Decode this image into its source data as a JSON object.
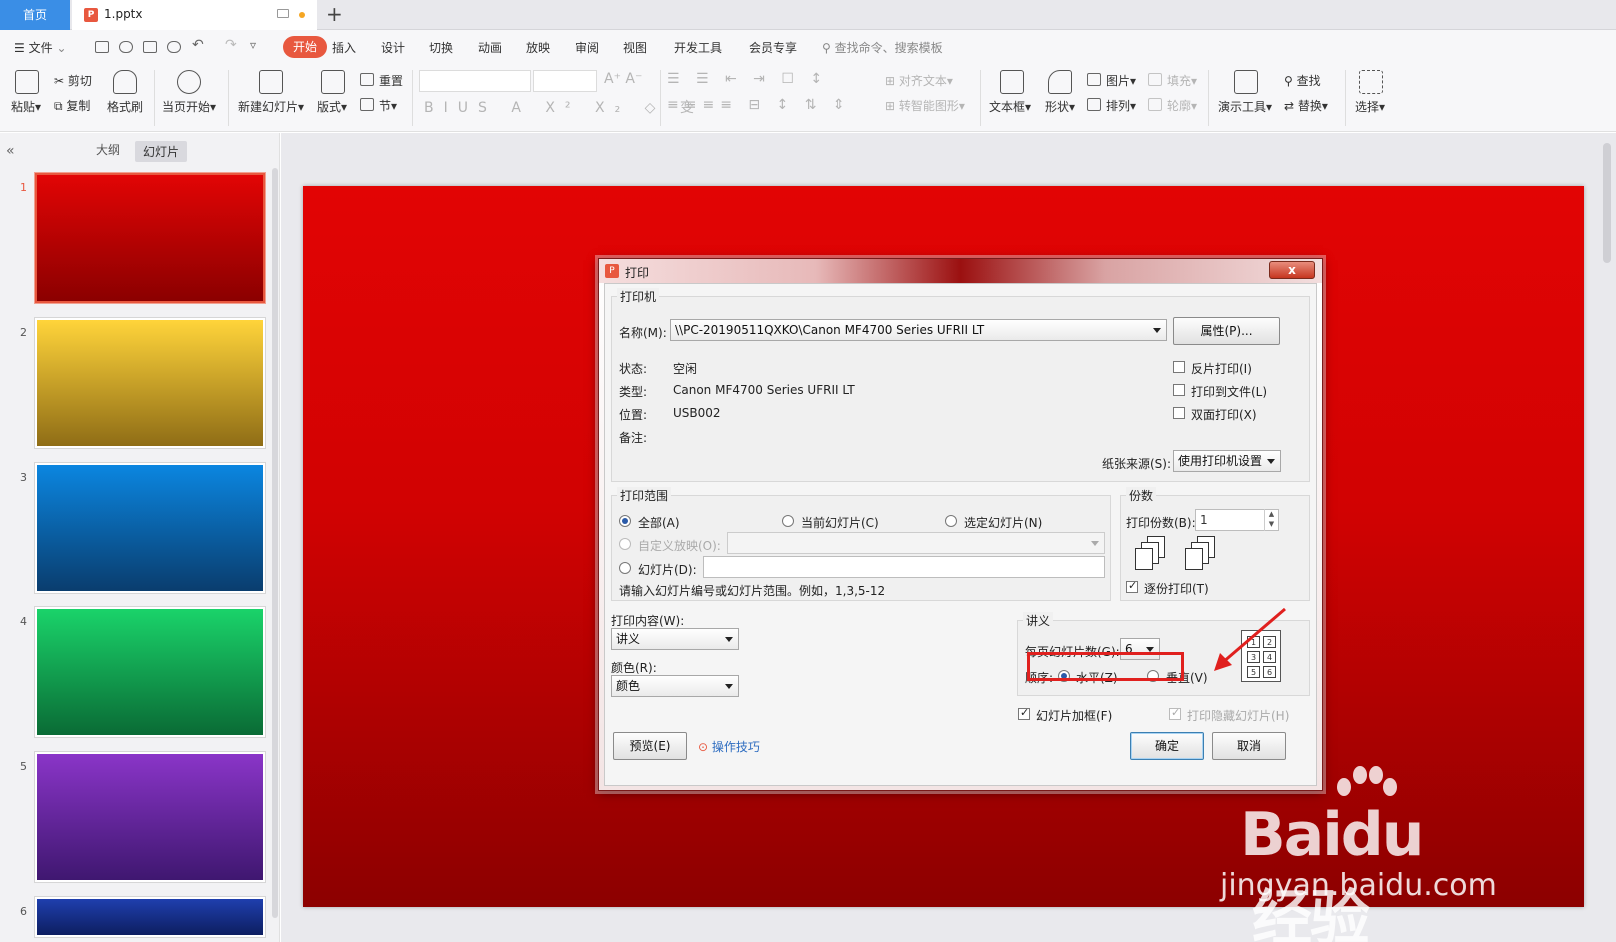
{
  "tabbar": {
    "home": "首页",
    "doc": "1.pptx",
    "logo": "P"
  },
  "menu": {
    "file": "文件",
    "tabs": [
      "开始",
      "插入",
      "设计",
      "切换",
      "动画",
      "放映",
      "审阅",
      "视图",
      "开发工具",
      "会员专享"
    ],
    "search": "查找命令、搜索模板"
  },
  "ribbon": {
    "paste": "粘贴",
    "cut": "剪切",
    "copy": "复制",
    "format_painter": "格式刷",
    "play_from_current": "当页开始",
    "new_slide": "新建幻灯片",
    "layout": "版式",
    "reset": "重置",
    "section": "节",
    "align_text": "对齐文本",
    "smart_art": "转智能图形",
    "textbox": "文本框",
    "shape": "形状",
    "arrange": "排列",
    "picture": "图片",
    "fill": "填充",
    "outline": "轮廓",
    "presentation_tools": "演示工具",
    "find": "查找",
    "replace": "替换",
    "select": "选择"
  },
  "leftpanel": {
    "tab_outline": "大纲",
    "tab_slides": "幻灯片",
    "slides": [
      {
        "num": "1",
        "top": "#e20505",
        "bottom": "#8b0000"
      },
      {
        "num": "2",
        "top": "#ffd43a",
        "bottom": "#8f6d16"
      },
      {
        "num": "3",
        "top": "#0b86e0",
        "bottom": "#0a3d6e"
      },
      {
        "num": "4",
        "top": "#1ad36a",
        "bottom": "#0a6b35"
      },
      {
        "num": "5",
        "top": "#8a35c8",
        "bottom": "#3f1770"
      },
      {
        "num": "6",
        "top": "#1f3fae",
        "bottom": "#0d1e60"
      }
    ]
  },
  "dialog": {
    "title": "打印",
    "close": "x",
    "printer_group": "打印机",
    "name_label": "名称(M):",
    "printer_name": "\\\\PC-20190511QXKO\\Canon MF4700 Series UFRII LT",
    "properties": "属性(P)...",
    "status_label": "状态:",
    "status_value": "空闲",
    "type_label": "类型:",
    "type_value": "Canon MF4700 Series UFRII LT",
    "location_label": "位置:",
    "location_value": "USB002",
    "comment_label": "备注:",
    "reverse_print": "反片打印(I)",
    "print_to_file": "打印到文件(L)",
    "duplex": "双面打印(X)",
    "paper_source_label": "纸张来源(S):",
    "paper_source": "使用打印机设置",
    "range_group": "打印范围",
    "range_all": "全部(A)",
    "range_current": "当前幻灯片(C)",
    "range_selected": "选定幻灯片(N)",
    "range_custom": "自定义放映(O):",
    "range_slides": "幻灯片(D):",
    "range_hint": "请输入幻灯片编号或幻灯片范围。例如，1,3,5-12",
    "copies_group": "份数",
    "copies_label": "打印份数(B):",
    "copies_value": "1",
    "collate": "逐份打印(T)",
    "content_label": "打印内容(W):",
    "content_value": "讲义",
    "color_label": "颜色(R):",
    "color_value": "颜色",
    "handout_group": "讲义",
    "per_page_label": "每页幻灯片数(G):",
    "per_page_value": "6",
    "order_label": "顺序:",
    "order_horizontal": "水平(Z)",
    "order_vertical": "垂直(V)",
    "frame_slides": "幻灯片加框(F)",
    "print_hidden": "打印隐藏幻灯片(H)",
    "preview": "预览(E)",
    "tips": "操作技巧",
    "ok": "确定",
    "cancel": "取消",
    "grid_numbers": [
      "1",
      "2",
      "3",
      "4",
      "5",
      "6"
    ],
    "collate_numbers": [
      "1",
      "2",
      "3"
    ]
  },
  "watermark": {
    "brand": "Bai",
    "paw_text": "du",
    "suffix": "经验",
    "url": "jingyan.baidu.com"
  }
}
